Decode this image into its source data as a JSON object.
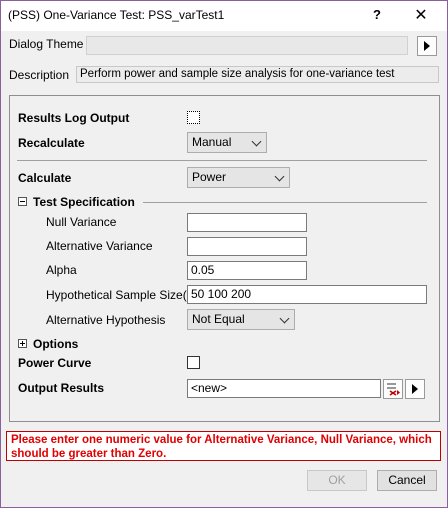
{
  "window": {
    "title": "(PSS) One-Variance Test: PSS_varTest1",
    "help": "?",
    "close": "✕"
  },
  "dialog_theme": {
    "label": "Dialog Theme"
  },
  "description": {
    "label": "Description",
    "text": "Perform power and sample size analysis for one-variance test"
  },
  "results_log_output": {
    "label": "Results Log Output",
    "checked": false
  },
  "recalculate": {
    "label": "Recalculate",
    "value": "Manual"
  },
  "calculate": {
    "label": "Calculate",
    "value": "Power"
  },
  "test_specification": {
    "label": "Test Specification",
    "null_variance": {
      "label": "Null Variance",
      "value": ""
    },
    "alternative_variance": {
      "label": "Alternative Variance",
      "value": ""
    },
    "alpha": {
      "label": "Alpha",
      "value": "0.05"
    },
    "hypothetical_sample_sizes": {
      "label": "Hypothetical Sample Size(s)",
      "value": "50 100 200"
    },
    "alternative_hypothesis": {
      "label": "Alternative Hypothesis",
      "value": "Not Equal"
    }
  },
  "options": {
    "label": "Options"
  },
  "power_curve": {
    "label": "Power Curve",
    "checked": false
  },
  "output_results": {
    "label": "Output Results",
    "value": "<new>"
  },
  "error_message": "Please enter one numeric value for Alternative Variance, Null Variance, which should be greater than Zero.",
  "buttons": {
    "ok": "OK",
    "cancel": "Cancel"
  },
  "colors": {
    "error_text": "#e00000",
    "error_border": "#c00000",
    "window_border": "#8a5fa0",
    "dialog_bg": "#f0f0f0"
  }
}
